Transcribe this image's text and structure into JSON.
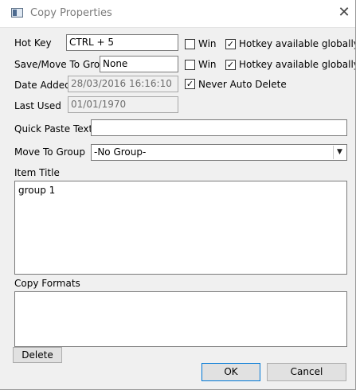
{
  "window": {
    "title": "Copy Properties",
    "app_icon": "window-icon",
    "close_icon": "close-icon"
  },
  "hotkey": {
    "label": "Hot Key",
    "value": "CTRL + 5",
    "win_label": "Win",
    "win_checked": false,
    "global_label": "Hotkey available globally",
    "global_checked": true
  },
  "group_hotkey": {
    "label": "Save/Move To Group",
    "value": "None",
    "win_label": "Win",
    "win_checked": false,
    "global_label": "Hotkey available globally",
    "global_checked": true
  },
  "date_added": {
    "label": "Date Added",
    "value": "28/03/2016 16:16:10"
  },
  "never_auto_delete": {
    "label": "Never Auto Delete",
    "checked": true
  },
  "last_used": {
    "label": "Last Used",
    "value": "01/01/1970"
  },
  "quick_paste": {
    "label": "Quick Paste Text",
    "value": ""
  },
  "move_to_group": {
    "label": "Move To Group",
    "selected": "-No Group-"
  },
  "item_title": {
    "label": "Item Title",
    "value": "group 1"
  },
  "copy_formats": {
    "label": "Copy Formats",
    "items": []
  },
  "buttons": {
    "delete": "Delete",
    "ok": "OK",
    "cancel": "Cancel"
  }
}
